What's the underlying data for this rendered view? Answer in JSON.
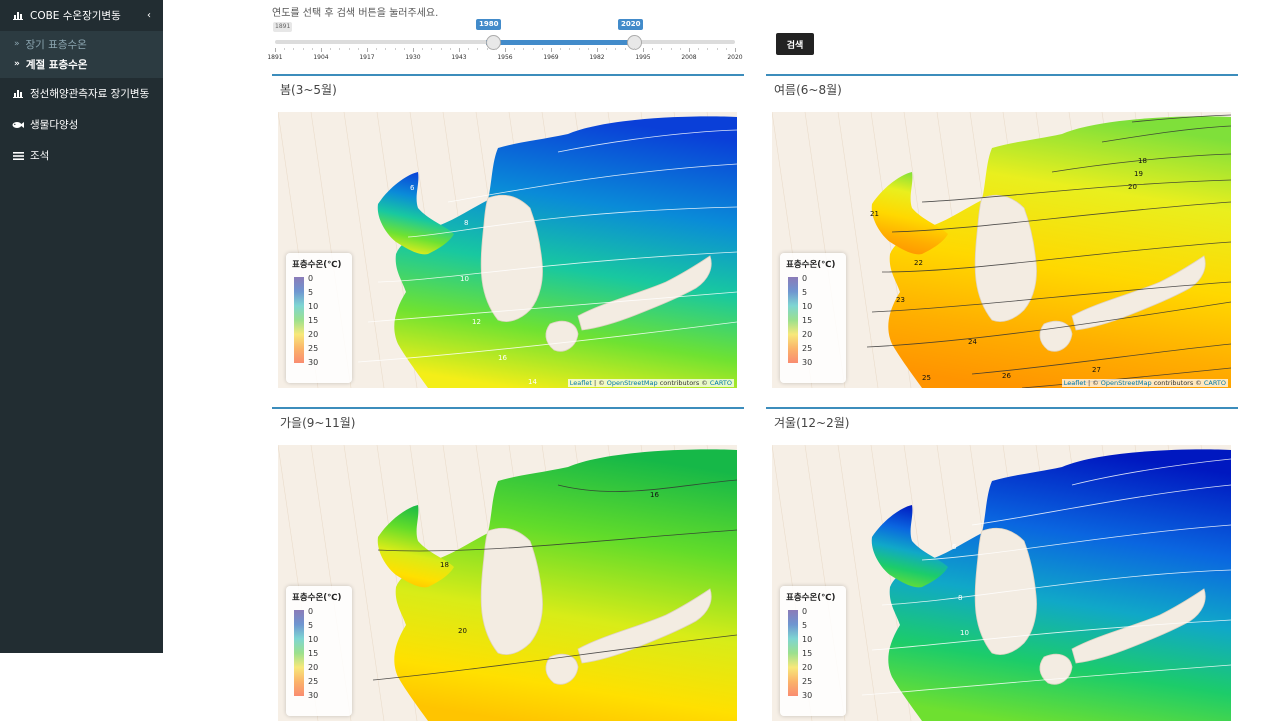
{
  "sidebar": {
    "items": [
      {
        "label": "COBE 수온장기변동",
        "icon": "bar-chart-icon",
        "expanded": true,
        "children": [
          {
            "label": "장기 표층수온",
            "active": false
          },
          {
            "label": "계절 표층수온",
            "active": true
          }
        ]
      },
      {
        "label": "정선해양관측자료 장기변동",
        "icon": "bar-chart-icon"
      },
      {
        "label": "생물다양성",
        "icon": "fish-icon"
      },
      {
        "label": "조석",
        "icon": "waves-icon"
      }
    ]
  },
  "filter": {
    "instruction": "연도를 선택 후 검색 버튼을 눌러주세요.",
    "slider": {
      "min": 1891,
      "max": 2020,
      "from": 1980,
      "to": 2020,
      "min_label": "1891",
      "from_label": "1980",
      "to_label": "2020",
      "ticks": [
        "1891",
        "1904",
        "1917",
        "1930",
        "1943",
        "1956",
        "1969",
        "1982",
        "1995",
        "2008",
        "2020"
      ]
    },
    "search_label": "검색"
  },
  "panels": [
    {
      "title": "봄(3~5월)",
      "scheme": "cool",
      "contour_labels": [
        "6",
        "8",
        "10",
        "12",
        "16",
        "14"
      ]
    },
    {
      "title": "여름(6~8월)",
      "scheme": "warm",
      "contour_labels": [
        "18",
        "19",
        "20",
        "21",
        "22",
        "23",
        "24",
        "25",
        "26",
        "27"
      ]
    },
    {
      "title": "가을(9~11월)",
      "scheme": "mid",
      "contour_labels": [
        "16",
        "18",
        "20"
      ]
    },
    {
      "title": "겨울(12~2월)",
      "scheme": "cold",
      "contour_labels": [
        "6",
        "8",
        "10"
      ]
    }
  ],
  "legend": {
    "title": "표층수온(℃)",
    "labels": [
      "0",
      "5",
      "10",
      "15",
      "20",
      "25",
      "30"
    ]
  },
  "attribution": {
    "leaflet": "Leaflet",
    "sep": " | © ",
    "osm": "OpenStreetMap",
    "contrib": " contributors © ",
    "carto": "CARTO"
  },
  "colors": {
    "sidebar_bg": "#222d32",
    "accent": "#3c8dbc",
    "slider_bar": "#428bca"
  }
}
